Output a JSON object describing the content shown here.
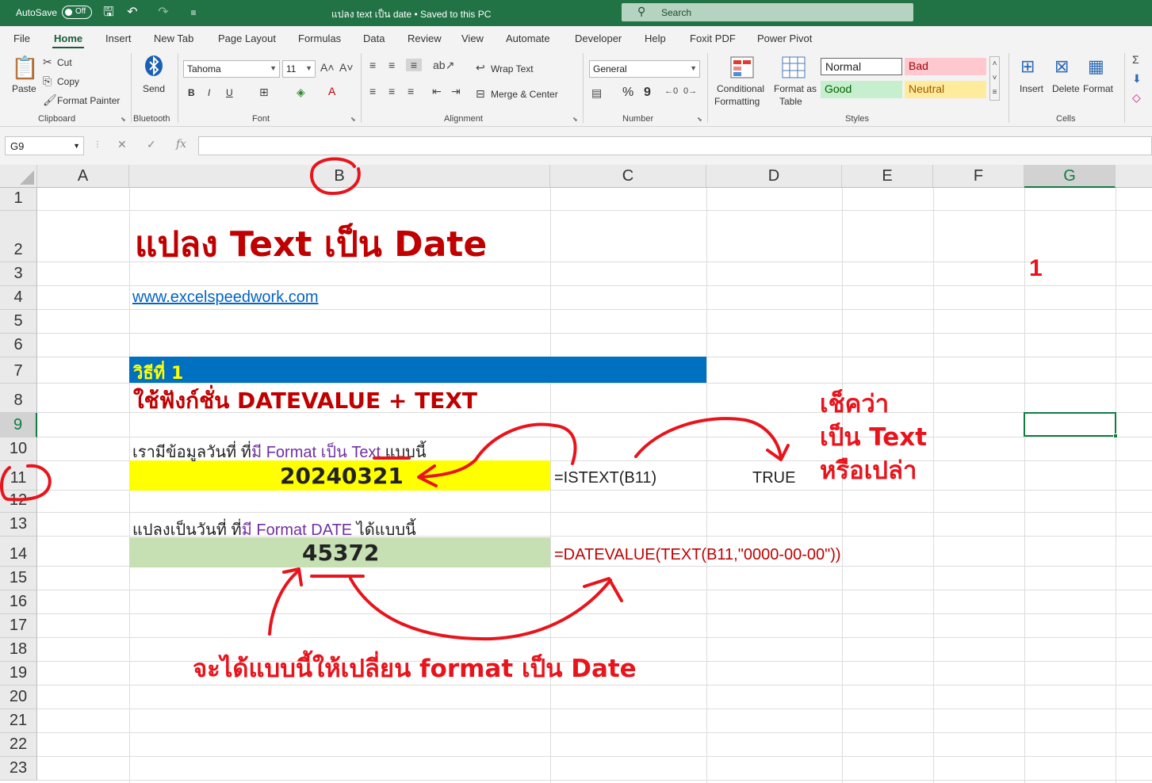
{
  "titlebar": {
    "autosave_label": "AutoSave",
    "autosave_state": "Off",
    "doc_title": "แปลง text เป็น date • Saved to this PC",
    "search_placeholder": "Search"
  },
  "menu_tabs": [
    "File",
    "Home",
    "Insert",
    "New Tab",
    "Page Layout",
    "Formulas",
    "Data",
    "Review",
    "View",
    "Automate",
    "Developer",
    "Help",
    "Foxit PDF",
    "Power Pivot"
  ],
  "ribbon": {
    "clipboard": {
      "paste": "Paste",
      "cut": "Cut",
      "copy": "Copy",
      "format_painter": "Format Painter",
      "label": "Clipboard"
    },
    "bluetooth": {
      "send": "Send",
      "label": "Bluetooth"
    },
    "font": {
      "name": "Tahoma",
      "size": "11",
      "bold": "B",
      "italic": "I",
      "underline": "U",
      "label": "Font"
    },
    "alignment": {
      "wrap_text": "Wrap Text",
      "merge_center": "Merge & Center",
      "label": "Alignment"
    },
    "number": {
      "format": "General",
      "percent": "%",
      "comma": "9",
      "label": "Number"
    },
    "styles": {
      "conditional_formatting_1": "Conditional",
      "conditional_formatting_2": "Formatting",
      "format_as_table_1": "Format as",
      "format_as_table_2": "Table",
      "normal": "Normal",
      "bad": "Bad",
      "good": "Good",
      "neutral": "Neutral",
      "label": "Styles"
    },
    "cells": {
      "insert": "Insert",
      "delete": "Delete",
      "format": "Format",
      "label": "Cells"
    }
  },
  "formula_bar": {
    "name_box": "G9",
    "cancel": "✕",
    "enter": "✓",
    "fx": "fx",
    "formula": ""
  },
  "columns": [
    "A",
    "B",
    "C",
    "D",
    "E",
    "F",
    "G"
  ],
  "rows": [
    "1",
    "2",
    "3",
    "4",
    "5",
    "6",
    "7",
    "8",
    "9",
    "10",
    "11",
    "12",
    "13",
    "14",
    "15",
    "16",
    "17",
    "18",
    "19",
    "20",
    "21",
    "22",
    "23"
  ],
  "sheet": {
    "title": "แปลง Text เป็น Date",
    "website": "www.excelspeedwork.com",
    "g3_value": "1",
    "method_label": "วิธีที่ 1",
    "method_desc": "ใช้ฟังก์ชั่น DATEVALUE + TEXT",
    "row10": {
      "p1": "เรามีข้อมูลวันที่ ที่",
      "p2": "มี Format เป็น Text",
      "p3": " แบบนี้"
    },
    "b11_value": "20240321",
    "c11_formula": "=ISTEXT(B11)",
    "d11_value": "TRUE",
    "row13": {
      "p1": "แปลงเป็นวันที่ ที่",
      "p2": "มี Format  DATE",
      "p3": " ได้แบบนี้"
    },
    "b14_value": "45372",
    "c14_formula": "=DATEVALUE(TEXT(B11,\"0000-00-00\"))"
  },
  "annotations": {
    "check_line1": "เช็คว่า",
    "check_line2": "เป็น Text",
    "check_line3": "หรือเปล่า",
    "bottom_note": "จะได้แบบนี้ให้เปลี่ยน format เป็น Date"
  },
  "colors": {
    "excel_green": "#217346",
    "title_red": "#c00000",
    "band_blue": "#0070c0",
    "band_yellow": "#ffff00",
    "band_green": "#c6e0b4",
    "annotation_red": "#e8141c",
    "purple_text": "#7030a0"
  }
}
